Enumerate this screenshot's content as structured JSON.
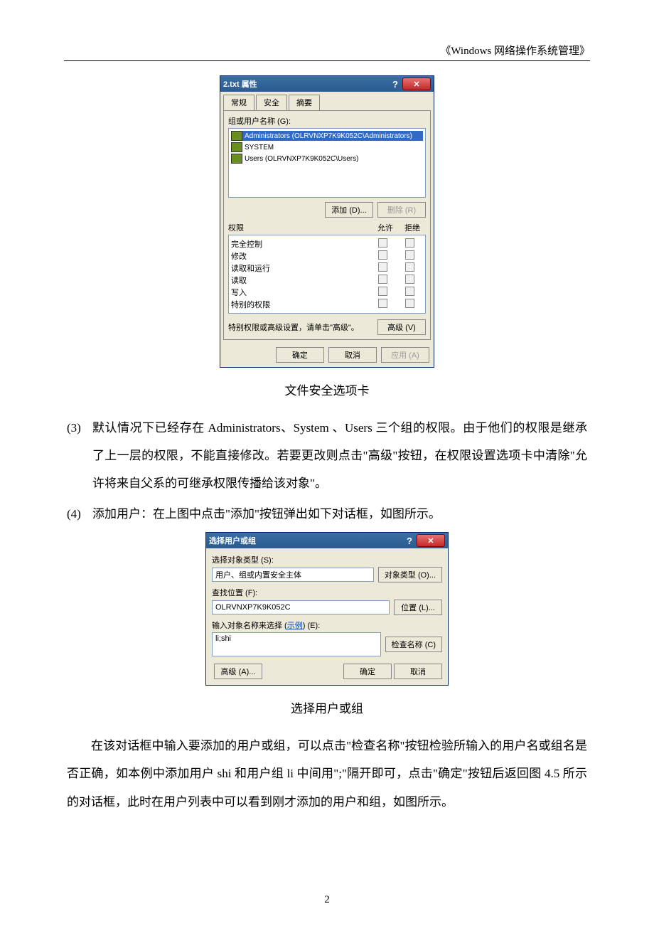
{
  "header": "《Windows 网络操作系统管理》",
  "page_number": "2",
  "dialog1": {
    "title": "2.txt 属性",
    "tabs": [
      "常规",
      "安全",
      "摘要"
    ],
    "group_label": "组或用户名称 (G):",
    "users": [
      "Administrators (OLRVNXP7K9K052C\\Administrators)",
      "SYSTEM",
      "Users (OLRVNXP7K9K052C\\Users)"
    ],
    "add_btn": "添加 (D)...",
    "remove_btn": "删除 (R)",
    "perm_header": {
      "col1": "权限",
      "col2": "允许",
      "col3": "拒绝"
    },
    "perms": [
      "完全控制",
      "修改",
      "读取和运行",
      "读取",
      "写入",
      "特别的权限"
    ],
    "adv_text": "特别权限或高级设置，请单击\"高级\"。",
    "adv_btn": "高级 (V)",
    "ok": "确定",
    "cancel": "取消",
    "apply": "应用 (A)"
  },
  "caption1": "文件安全选项卡",
  "para3_num": "(3)",
  "para3": "默认情况下已经存在 Administrators、System 、Users 三个组的权限。由于他们的权限是继承了上一层的权限，不能直接修改。若要更改则点击\"高级\"按钮，在权限设置选项卡中清除\"允许将来自父系的可继承权限传播给该对象\"。",
  "para4_num": "(4)",
  "para4": "添加用户：在上图中点击\"添加\"按钮弹出如下对话框，如图所示。",
  "dialog2": {
    "title": "选择用户或组",
    "obj_type_label": "选择对象类型 (S):",
    "obj_type_value": "用户、组或内置安全主体",
    "obj_type_btn": "对象类型 (O)...",
    "loc_label": "查找位置 (F):",
    "loc_value": "OLRVNXP7K9K052C",
    "loc_btn": "位置 (L)...",
    "name_label_pre": "输入对象名称来选择 (",
    "name_label_link": "示例",
    "name_label_post": ") (E):",
    "name_value": "li;shi",
    "check_btn": "检查名称 (C)",
    "adv_btn": "高级 (A)...",
    "ok": "确定",
    "cancel": "取消"
  },
  "caption2": "选择用户或组",
  "para5": "在该对话框中输入要添加的用户或组，可以点击\"检查名称\"按钮检验所输入的用户名或组名是否正确，如本例中添加用户 shi 和用户组 li 中间用\";\"隔开即可，点击\"确定\"按钮后返回图 4.5 所示的对话框，此时在用户列表中可以看到刚才添加的用户和组，如图所示。"
}
